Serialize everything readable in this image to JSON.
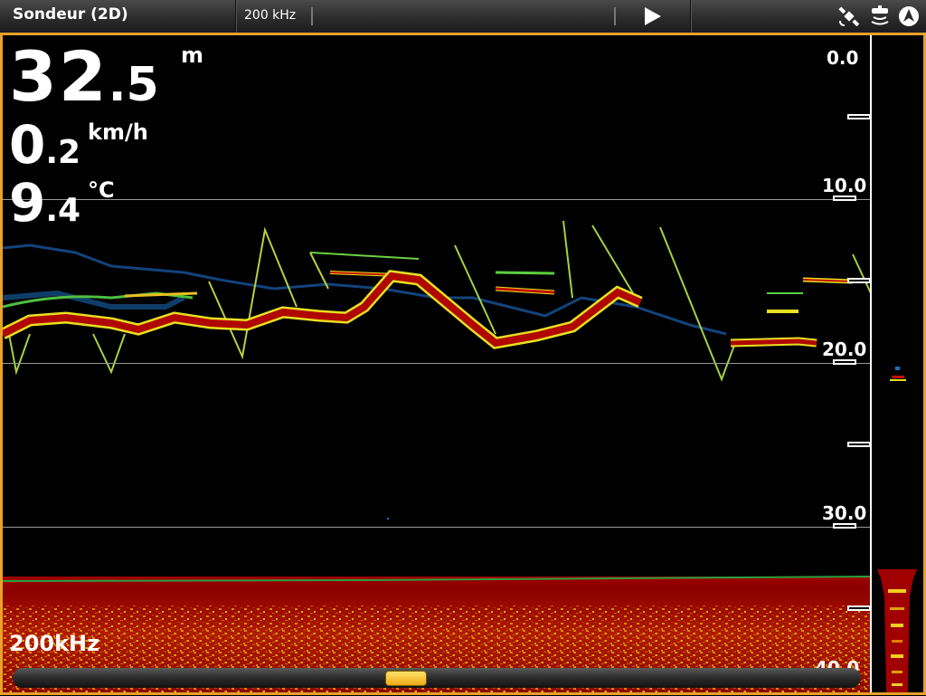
{
  "topbar": {
    "title": "Sondeur (2D)",
    "frequency": "200 kHz",
    "icons": [
      "play-icon",
      "gps-satellite-icon",
      "sonar-transducer-icon",
      "navigation-arrow-icon"
    ]
  },
  "readouts": {
    "depth_int": "32",
    "depth_dec": ".5",
    "depth_unit": "m",
    "speed_int": "0",
    "speed_dec": ".2",
    "speed_unit": "km/h",
    "temp_int": "9",
    "temp_dec": ".4",
    "temp_unit": "°C"
  },
  "depth_scale": {
    "labels": [
      "0.0",
      "10.0",
      "20.0",
      "30.0",
      "40.0"
    ]
  },
  "frequency_label": "200kHz",
  "colors": {
    "accent_frame": "#e9a12a",
    "bottom_echo": "#a00000",
    "fish_echo_strong": "#c01000",
    "fish_echo_mid": "#e8e020",
    "fish_echo_weak": "#1a70c0"
  }
}
